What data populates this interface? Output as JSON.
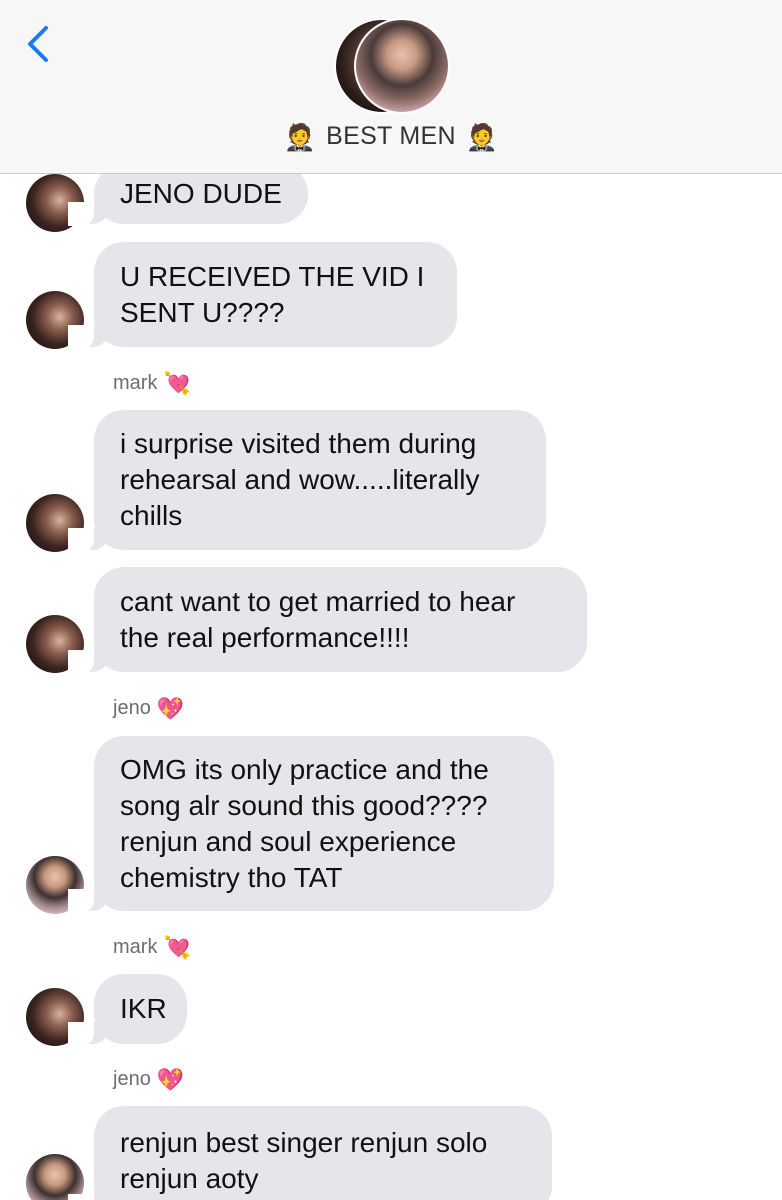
{
  "header": {
    "title": "BEST MEN",
    "title_emoji": "🤵"
  },
  "messages": [
    {
      "text": "JENO DUDE",
      "from": "mark"
    },
    {
      "text": "U RECEIVED THE VID I\nSENT U????",
      "from": "mark"
    },
    {
      "sender_label": "mark",
      "sender_emoji": "💘"
    },
    {
      "text": "i surprise visited them during\nrehearsal and wow.....literally\nchills",
      "from": "mark"
    },
    {
      "text": "cant want to get married to hear\nthe real performance!!!!",
      "from": "mark"
    },
    {
      "sender_label": "jeno",
      "sender_emoji": "💖"
    },
    {
      "text": "OMG its only practice and the\nsong alr sound this good????\nrenjun and soul experience\nchemistry tho TAT",
      "from": "jeno"
    },
    {
      "sender_label": "mark",
      "sender_emoji": "💘"
    },
    {
      "text": "IKR",
      "from": "mark"
    },
    {
      "sender_label": "jeno",
      "sender_emoji": "💖"
    },
    {
      "text": "renjun best singer renjun solo\nrenjun aoty",
      "from": "jeno"
    }
  ],
  "icons": {
    "back": "chevron-left-icon",
    "accent": "#1a7cf5",
    "bubble_color": "#e5e5ea"
  }
}
